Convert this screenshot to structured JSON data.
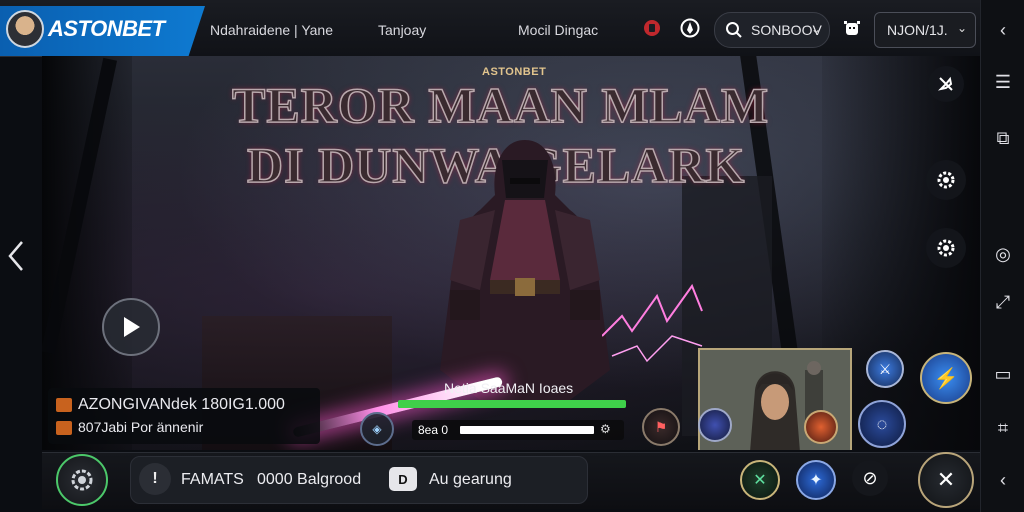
{
  "header": {
    "brand_name": "ASTONBET",
    "nav": [
      "Ndahraidene | Yane",
      "Tanjoay",
      "Mocil Dingac"
    ],
    "search_value": "SONBOOV",
    "account_label": "NJON/1J."
  },
  "banner": {
    "small_logo": "ASTONBET",
    "title_lines": [
      "TEROR MAAN MLAM",
      "DI DUNWA GELARK"
    ]
  },
  "info": {
    "line1": "AZONGIVANdek 180IG1.000",
    "line2": "807Jabi Por ännenir"
  },
  "progress": {
    "label": "Netia SaaMaN Ioaes",
    "percent": 100,
    "mini_text": "8ea 0"
  },
  "bottom": {
    "label1": "FAMATS",
    "label2": "0000 Balgrood",
    "badge": "D",
    "label3": "Au gearung"
  },
  "colors": {
    "brand_blue": "#0e7ad1",
    "accent_green": "#3fd04a",
    "magenta_glow": "#ff8ee8",
    "chip_orange": "#c8621e"
  },
  "icons": [
    "avatar",
    "shield-icon",
    "alien-icon",
    "search-icon",
    "bug-icon",
    "chevron-down-icon",
    "chevron-left-icon",
    "menu-icon",
    "copy-icon",
    "target-icon",
    "folder-icon",
    "layers-icon",
    "gear-icon",
    "play-icon",
    "sword-icon"
  ]
}
